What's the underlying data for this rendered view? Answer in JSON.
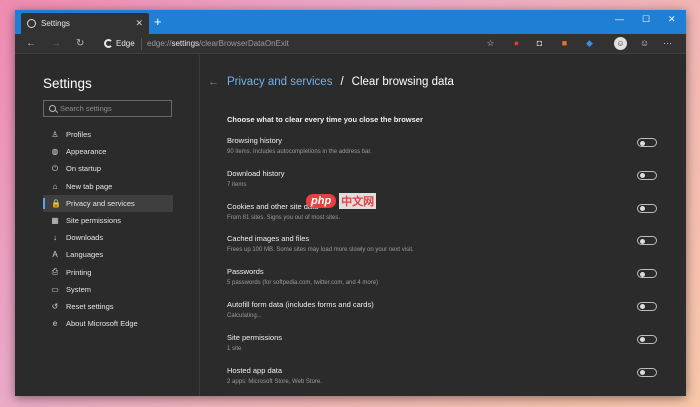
{
  "tab": {
    "title": "Settings"
  },
  "window_controls": {
    "minimize": "—",
    "maximize": "☐",
    "close": "✕"
  },
  "addressbar": {
    "brand": "Edge",
    "url_prefix": "edge://",
    "url_host": "settings",
    "url_path": "/clearBrowserDataOnExit"
  },
  "sidebar": {
    "title": "Settings",
    "search_placeholder": "Search settings",
    "items": [
      {
        "label": "Profiles",
        "icon": "person-icon"
      },
      {
        "label": "Appearance",
        "icon": "palette-icon"
      },
      {
        "label": "On startup",
        "icon": "power-icon"
      },
      {
        "label": "New tab page",
        "icon": "home-icon"
      },
      {
        "label": "Privacy and services",
        "icon": "lock-icon",
        "active": true
      },
      {
        "label": "Site permissions",
        "icon": "grid-icon"
      },
      {
        "label": "Downloads",
        "icon": "download-icon"
      },
      {
        "label": "Languages",
        "icon": "language-icon"
      },
      {
        "label": "Printing",
        "icon": "printer-icon"
      },
      {
        "label": "System",
        "icon": "monitor-icon"
      },
      {
        "label": "Reset settings",
        "icon": "reset-icon"
      },
      {
        "label": "About Microsoft Edge",
        "icon": "edge-icon"
      }
    ]
  },
  "page": {
    "breadcrumb_parent": "Privacy and services",
    "breadcrumb_separator": "/",
    "title": "Clear browsing data",
    "section": "Choose what to clear every time you close the browser",
    "options": [
      {
        "title": "Browsing history",
        "detail": "90 items. Includes autocompletions in the address bar.",
        "enabled": false
      },
      {
        "title": "Download history",
        "detail": "7 items",
        "enabled": false
      },
      {
        "title": "Cookies and other site data",
        "detail": "From 81 sites. Signs you out of most sites.",
        "enabled": false
      },
      {
        "title": "Cached images and files",
        "detail": "Frees up 100 MB. Some sites may load more slowly on your next visit.",
        "enabled": false
      },
      {
        "title": "Passwords",
        "detail": "5 passwords (for softpedia.com, twitter.com, and 4 more)",
        "enabled": false
      },
      {
        "title": "Autofill form data (includes forms and cards)",
        "detail": "Calculating...",
        "enabled": false
      },
      {
        "title": "Site permissions",
        "detail": "1 site",
        "enabled": false
      },
      {
        "title": "Hosted app data",
        "detail": "2 apps: Microsoft Store, Web Store.",
        "enabled": false
      }
    ]
  },
  "watermark": {
    "logo": "php",
    "text": "中文网"
  },
  "colors": {
    "accent": "#1f7fd4",
    "link": "#6fb1ee",
    "background": "#2b2b2b"
  }
}
